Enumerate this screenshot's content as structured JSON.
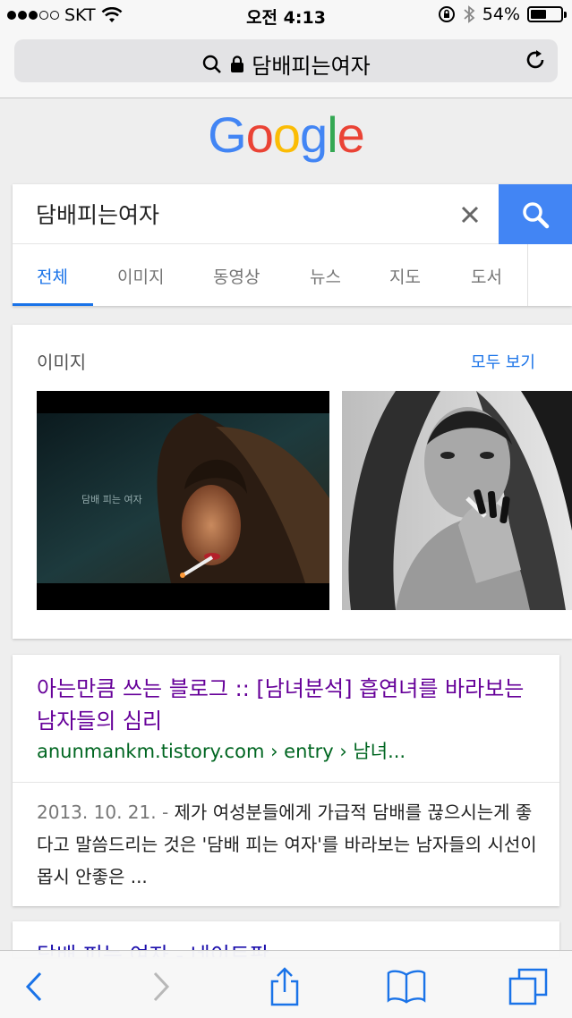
{
  "status_bar": {
    "carrier": "SKT",
    "time": "오전 4:13",
    "battery": "54%",
    "battery_level": 0.54
  },
  "url_bar": {
    "query": "담배피는여자"
  },
  "logo": {
    "letters": [
      "G",
      "o",
      "o",
      "g",
      "l",
      "e"
    ],
    "colors": [
      "#4285f4",
      "#ea4335",
      "#fbbc05",
      "#4285f4",
      "#34a853",
      "#ea4335"
    ]
  },
  "search": {
    "value": "담배피는여자",
    "tabs": [
      "전체",
      "이미지",
      "동영상",
      "뉴스",
      "지도",
      "도서"
    ],
    "active_tab": 0
  },
  "images_section": {
    "title": "이미지",
    "see_all": "모두 보기",
    "caption_overlay": "담배 피는 여자"
  },
  "result": {
    "title": "아는만큼 쓰는 블로그 :: [남녀분석] 흡연녀를 바라보는 남자들의 심리",
    "url": "anunmankm.tistory.com › entry › 남녀...",
    "date": "2013. 10. 21. -",
    "snippet": "제가 여성분들에게 가급적 담배를 끊으시는게 좋다고 말씀드리는 것은 '담배 피는 여자'를 바라보는 남자들의 시선이 몹시 안좋은 ..."
  },
  "next_result": {
    "title": "담배 피는 여자 - 네이트판"
  },
  "colors": {
    "accent": "#4285f4",
    "link_visited": "#660099",
    "url_green": "#006621",
    "tab_active": "#1a73e8"
  }
}
